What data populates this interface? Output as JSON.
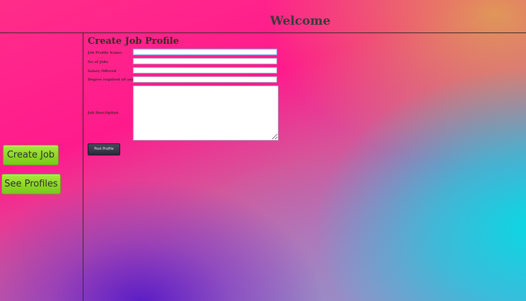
{
  "header": {
    "title": "Welcome"
  },
  "sidebar": {
    "create_job_label": "Create Job",
    "see_profiles_label": "See Profiles"
  },
  "form": {
    "title": "Create Job Profile",
    "fields": [
      {
        "label": "Job Profile Name:",
        "value": ""
      },
      {
        "label": "No of Jobs",
        "value": ""
      },
      {
        "label": "Salary Offered",
        "value": ""
      },
      {
        "label": "Degree required (if any)",
        "value": ""
      }
    ],
    "description_label": "Job Description",
    "description_value": "",
    "submit_label": "Post Profile"
  },
  "colors": {
    "button_green": "#8ad62a",
    "submit_dark": "#333344",
    "divider": "#3a2a2a"
  }
}
